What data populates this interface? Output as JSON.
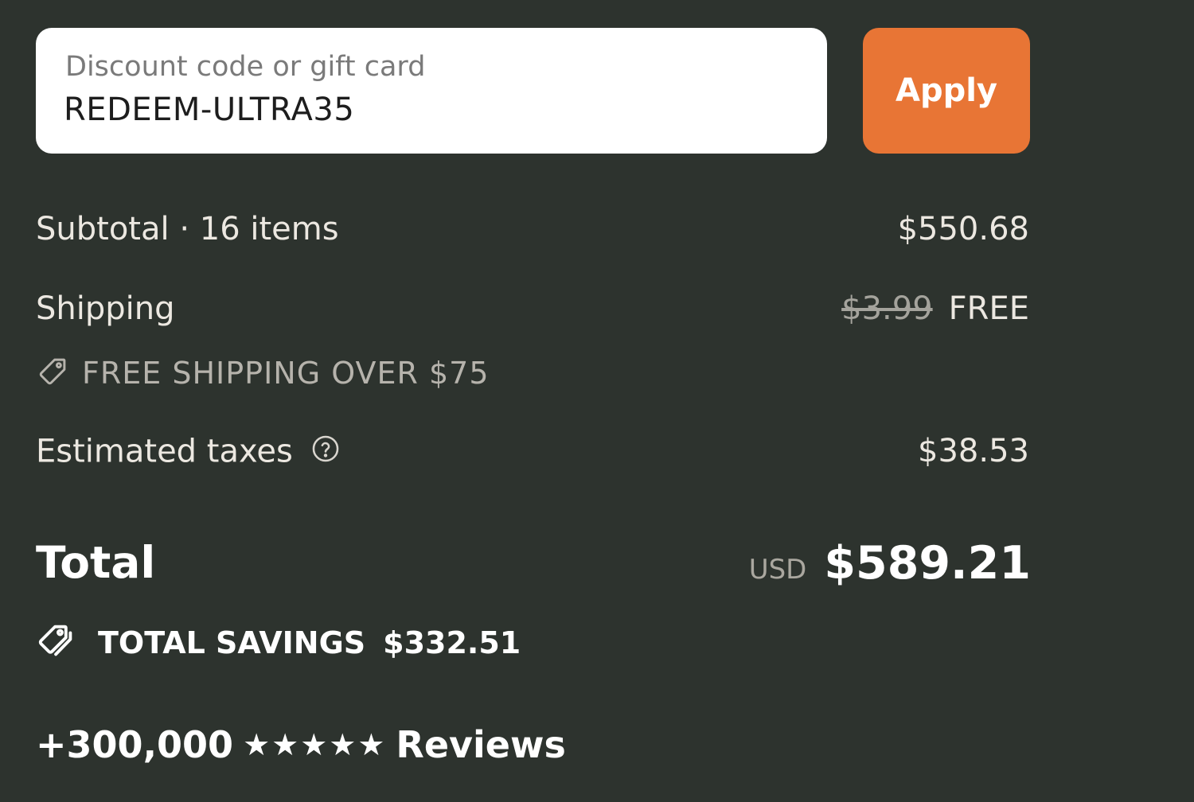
{
  "discount": {
    "placeholder": "Discount code or gift card",
    "value": "REDEEM-ULTRA35",
    "apply_label": "Apply"
  },
  "subtotal": {
    "label": "Subtotal · 16 items",
    "value": "$550.68"
  },
  "shipping": {
    "label": "Shipping",
    "original_price": "$3.99",
    "value": "FREE",
    "promo_text": "FREE SHIPPING OVER $75",
    "promo_icon": "tag-icon"
  },
  "taxes": {
    "label": "Estimated taxes",
    "help_icon": "question-circle-icon",
    "value": "$38.53"
  },
  "total": {
    "label": "Total",
    "currency": "USD",
    "value": "$589.21"
  },
  "savings": {
    "icon": "tags-icon",
    "label": "TOTAL SAVINGS",
    "value": "$332.51"
  },
  "reviews": {
    "count": "+300,000",
    "stars": "★★★★★",
    "label": "Reviews"
  },
  "colors": {
    "background": "#2d332e",
    "accent": "#e87535",
    "text": "#ece8e1",
    "muted": "#b6b3ac"
  }
}
